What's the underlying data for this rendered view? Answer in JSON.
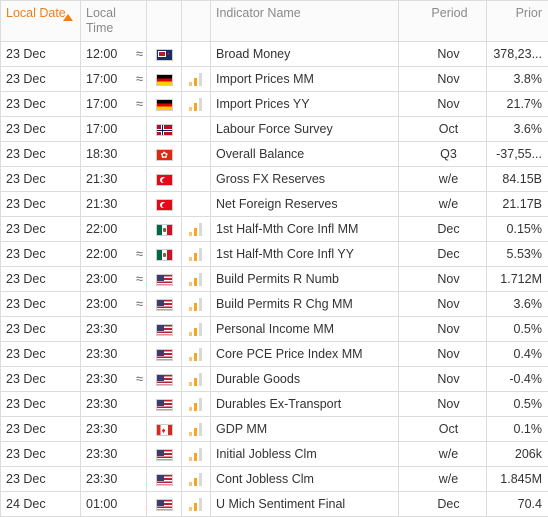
{
  "headers": {
    "local_date": "Local Date",
    "local_time": "Local Time",
    "indicator_name": "Indicator Name",
    "period": "Period",
    "prior": "Prior"
  },
  "colors": {
    "accent": "#f07f1a",
    "volatility": "#f5a623"
  },
  "rows": [
    {
      "date": "23 Dec",
      "time": "12:00",
      "tilde": "≈",
      "flag": "nz-flag-icon",
      "vol": "",
      "name": "Broad Money",
      "period": "Nov",
      "prior": "378,23..."
    },
    {
      "date": "23 Dec",
      "time": "17:00",
      "tilde": "≈",
      "flag": "de-flag-icon",
      "vol": "volatility-bars-icon",
      "name": "Import Prices MM",
      "period": "Nov",
      "prior": "3.8%"
    },
    {
      "date": "23 Dec",
      "time": "17:00",
      "tilde": "≈",
      "flag": "de-flag-icon",
      "vol": "volatility-bars-icon",
      "name": "Import Prices YY",
      "period": "Nov",
      "prior": "21.7%"
    },
    {
      "date": "23 Dec",
      "time": "17:00",
      "tilde": "",
      "flag": "no-flag-icon",
      "vol": "",
      "name": "Labour Force Survey",
      "period": "Oct",
      "prior": "3.6%"
    },
    {
      "date": "23 Dec",
      "time": "18:30",
      "tilde": "",
      "flag": "hk-flag-icon",
      "vol": "",
      "name": "Overall Balance",
      "period": "Q3",
      "prior": "-37,55..."
    },
    {
      "date": "23 Dec",
      "time": "21:30",
      "tilde": "",
      "flag": "tr-flag-icon",
      "vol": "",
      "name": "Gross FX Reserves",
      "period": "w/e",
      "prior": "84.15B"
    },
    {
      "date": "23 Dec",
      "time": "21:30",
      "tilde": "",
      "flag": "tr-flag-icon",
      "vol": "",
      "name": "Net Foreign Reserves",
      "period": "w/e",
      "prior": "21.17B"
    },
    {
      "date": "23 Dec",
      "time": "22:00",
      "tilde": "",
      "flag": "mx-flag-icon",
      "vol": "volatility-bars-icon",
      "name": "1st Half-Mth Core Infl MM",
      "period": "Dec",
      "prior": "0.15%"
    },
    {
      "date": "23 Dec",
      "time": "22:00",
      "tilde": "≈",
      "flag": "mx-flag-icon",
      "vol": "volatility-bars-icon",
      "name": "1st Half-Mth Core Infl YY",
      "period": "Dec",
      "prior": "5.53%"
    },
    {
      "date": "23 Dec",
      "time": "23:00",
      "tilde": "≈",
      "flag": "us-flag-icon",
      "vol": "volatility-bars-icon",
      "name": "Build Permits R Numb",
      "period": "Nov",
      "prior": "1.712M"
    },
    {
      "date": "23 Dec",
      "time": "23:00",
      "tilde": "≈",
      "flag": "us-flag-icon",
      "vol": "volatility-bars-icon",
      "name": "Build Permits R Chg MM",
      "period": "Nov",
      "prior": "3.6%"
    },
    {
      "date": "23 Dec",
      "time": "23:30",
      "tilde": "",
      "flag": "us-flag-icon",
      "vol": "volatility-bars-icon",
      "name": "Personal Income MM",
      "period": "Nov",
      "prior": "0.5%"
    },
    {
      "date": "23 Dec",
      "time": "23:30",
      "tilde": "",
      "flag": "us-flag-icon",
      "vol": "volatility-bars-icon",
      "name": "Core PCE Price Index MM",
      "period": "Nov",
      "prior": "0.4%"
    },
    {
      "date": "23 Dec",
      "time": "23:30",
      "tilde": "≈",
      "flag": "us-flag-icon",
      "vol": "volatility-bars-icon",
      "name": "Durable Goods",
      "period": "Nov",
      "prior": "-0.4%"
    },
    {
      "date": "23 Dec",
      "time": "23:30",
      "tilde": "",
      "flag": "us-flag-icon",
      "vol": "volatility-bars-icon",
      "name": "Durables Ex-Transport",
      "period": "Nov",
      "prior": "0.5%"
    },
    {
      "date": "23 Dec",
      "time": "23:30",
      "tilde": "",
      "flag": "ca-flag-icon",
      "vol": "volatility-bars-icon",
      "name": "GDP MM",
      "period": "Oct",
      "prior": "0.1%"
    },
    {
      "date": "23 Dec",
      "time": "23:30",
      "tilde": "",
      "flag": "us-flag-icon",
      "vol": "volatility-bars-icon",
      "name": "Initial Jobless Clm",
      "period": "w/e",
      "prior": "206k"
    },
    {
      "date": "23 Dec",
      "time": "23:30",
      "tilde": "",
      "flag": "us-flag-icon",
      "vol": "volatility-bars-icon",
      "name": "Cont Jobless Clm",
      "period": "w/e",
      "prior": "1.845M"
    },
    {
      "date": "24 Dec",
      "time": "01:00",
      "tilde": "",
      "flag": "us-flag-icon",
      "vol": "volatility-bars-icon",
      "name": "U Mich Sentiment Final",
      "period": "Dec",
      "prior": "70.4"
    }
  ]
}
